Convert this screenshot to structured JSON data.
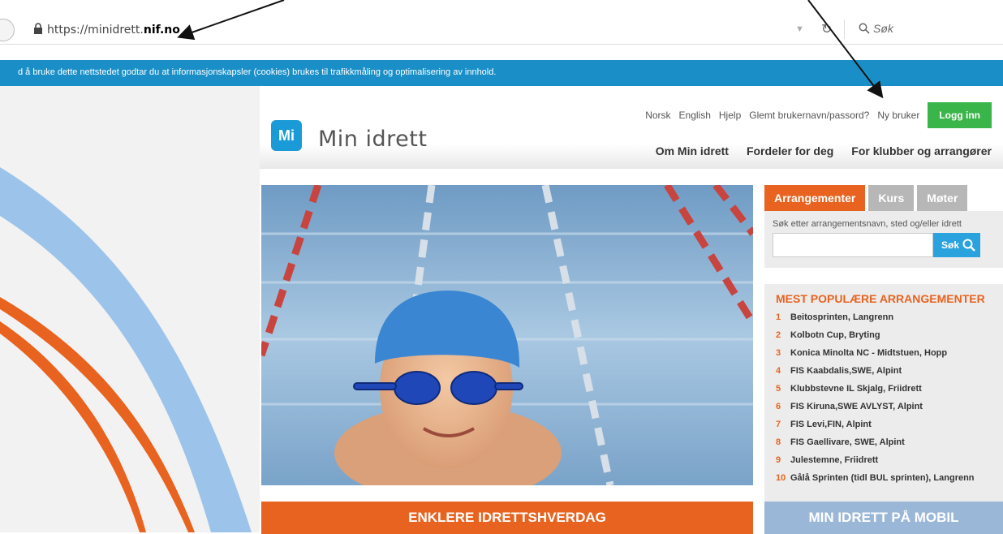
{
  "browser": {
    "url_prefix": "https://minidrett.",
    "url_domain": "nif.no",
    "search_placeholder": "Søk"
  },
  "cookie_notice": "d å bruke dette nettstedet godtar du at informasjonskapsler (cookies) brukes til trafikkmåling og optimalisering av innhold.",
  "header": {
    "logo_mark": "Mi",
    "logo_text": "Min idrett",
    "top_links": [
      "Norsk",
      "English",
      "Hjelp",
      "Glemt brukernavn/passord?",
      "Ny bruker"
    ],
    "login_label": "Logg inn",
    "nav": [
      "Om Min idrett",
      "Fordeler for deg",
      "For klubber og arrangører"
    ]
  },
  "sidebar": {
    "tabs": [
      "Arrangementer",
      "Kurs",
      "Møter"
    ],
    "search_hint": "Søk etter arrangementsnavn, sted og/eller idrett",
    "search_button": "Søk",
    "popular_title": "MEST POPULÆRE ARRANGEMENTER",
    "popular_items": [
      {
        "num": "1",
        "label": "Beitosprinten, Langrenn"
      },
      {
        "num": "2",
        "label": "Kolbotn Cup, Bryting"
      },
      {
        "num": "3",
        "label": "Konica Minolta NC - Midtstuen, Hopp"
      },
      {
        "num": "4",
        "label": "FIS Kaabdalis,SWE, Alpint"
      },
      {
        "num": "5",
        "label": "Klubbstevne IL Skjalg, Friidrett"
      },
      {
        "num": "6",
        "label": "FIS Kiruna,SWE AVLYST, Alpint"
      },
      {
        "num": "7",
        "label": "FIS Levi,FIN, Alpint"
      },
      {
        "num": "8",
        "label": "FIS Gaellivare, SWE, Alpint"
      },
      {
        "num": "9",
        "label": "Julestemne, Friidrett"
      },
      {
        "num": "10",
        "label": "Gålå Sprinten (tidl BUL sprinten), Langrenn"
      }
    ]
  },
  "banners": {
    "orange": "ENKLERE IDRETTSHVERDAG",
    "blue": "MIN IDRETT PÅ MOBIL"
  },
  "colors": {
    "brand_blue": "#1a9ad6",
    "accent_orange": "#e8631f",
    "login_green": "#3ab54a"
  }
}
